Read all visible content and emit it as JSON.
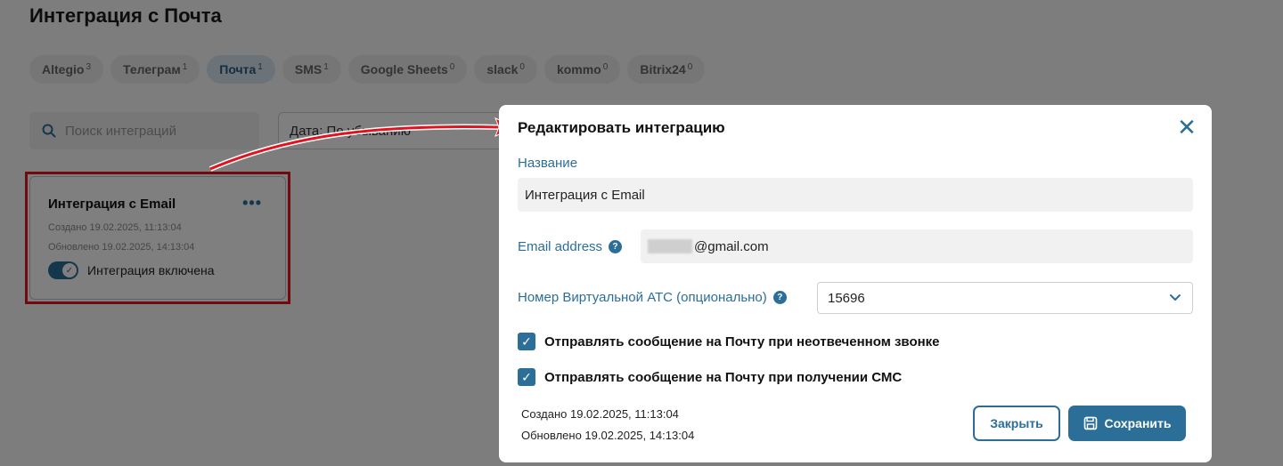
{
  "page": {
    "title": "Интеграция с Почта"
  },
  "tabs": [
    {
      "label": "Altegio",
      "count": "3"
    },
    {
      "label": "Телеграм",
      "count": "1"
    },
    {
      "label": "Почта",
      "count": "1"
    },
    {
      "label": "SMS",
      "count": "1"
    },
    {
      "label": "Google Sheets",
      "count": "0"
    },
    {
      "label": "slack",
      "count": "0"
    },
    {
      "label": "kommo",
      "count": "0"
    },
    {
      "label": "Bitrix24",
      "count": "0"
    }
  ],
  "search": {
    "placeholder": "Поиск интеграций",
    "icon": "search-icon"
  },
  "sort": {
    "value": "Дата: По убыванию"
  },
  "card": {
    "title": "Интеграция с Email",
    "more_icon": "•••",
    "created": "Создано 19.02.2025, 11:13:04",
    "updated": "Обновлено 19.02.2025, 14:13:04",
    "toggle_label": "Интеграция включена",
    "toggle_state": "on"
  },
  "modal": {
    "title": "Редактировать интеграцию",
    "close_icon": "✕",
    "name_label": "Название",
    "name_value": "Интеграция с Email",
    "email_label": "Email address",
    "email_value": "@gmail.com",
    "atc_label": "Номер Виртуальной АТС (опционально)",
    "atc_value": "15696",
    "help_icon": "?",
    "check1_label": "Отправлять сообщение на Почту при неотвеченном звонке",
    "check1_checked": true,
    "check2_label": "Отправлять сообщение на Почту при получении СМС",
    "check2_checked": true,
    "created": "Создано 19.02.2025, 11:13:04",
    "updated": "Обновлено 19.02.2025, 14:13:04",
    "close_button": "Закрыть",
    "save_button": "Сохранить"
  },
  "colors": {
    "accent": "#2b6f98",
    "highlight": "#e0141e"
  }
}
